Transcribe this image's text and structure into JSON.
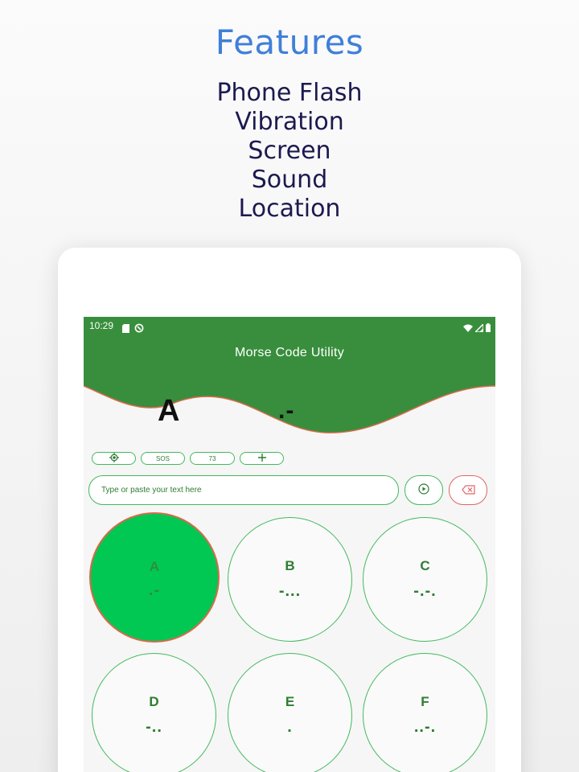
{
  "promo": {
    "title": "Features",
    "features": [
      "Phone Flash",
      "Vibration",
      "Screen",
      "Sound",
      "Location"
    ]
  },
  "status_bar": {
    "time": "10:29",
    "left_icons": [
      "sim-card-icon",
      "sync-icon"
    ],
    "right_icons": [
      "wifi-icon",
      "signal-icon",
      "battery-icon"
    ]
  },
  "app_bar": {
    "title": "Morse Code Utility"
  },
  "display": {
    "letter": "A",
    "morse": ".-"
  },
  "quick_actions": [
    {
      "icon": "location-target-icon",
      "label": ""
    },
    {
      "icon": "",
      "label": "SOS"
    },
    {
      "icon": "",
      "label": "73"
    },
    {
      "icon": "plus-icon",
      "label": ""
    }
  ],
  "input": {
    "placeholder": "Type or paste your text here",
    "value": ""
  },
  "keys": [
    {
      "letter": "A",
      "morse": ".-",
      "active": true
    },
    {
      "letter": "B",
      "morse": "-...",
      "active": false
    },
    {
      "letter": "C",
      "morse": "-.-.",
      "active": false
    },
    {
      "letter": "D",
      "morse": "-..",
      "active": false
    },
    {
      "letter": "E",
      "morse": ".",
      "active": false
    },
    {
      "letter": "F",
      "morse": "..-.",
      "active": false
    }
  ],
  "colors": {
    "app_green": "#388e3c",
    "accent_green": "#43b95c",
    "active_key": "#00c853",
    "active_border": "#d86a4a",
    "title_blue": "#3f7fd9",
    "feature_navy": "#1b1a4f",
    "clear_red": "#e06666"
  }
}
